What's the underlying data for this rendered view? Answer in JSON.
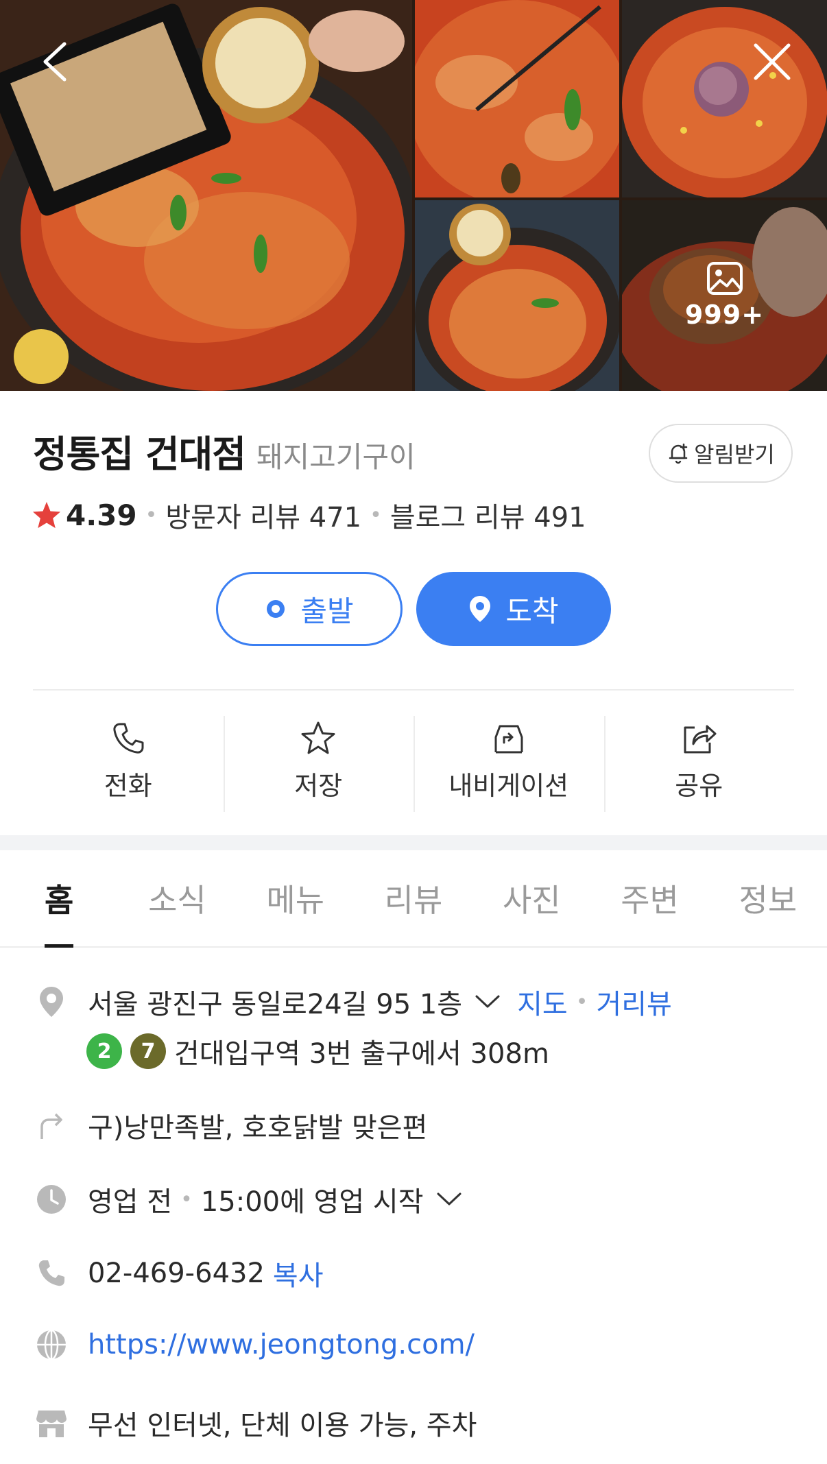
{
  "gallery": {
    "more_count": "999+"
  },
  "place": {
    "name": "정통집 건대점",
    "category": "돼지고기구이",
    "alarm_label": "알림받기",
    "rating": "4.39",
    "visitor_reviews": "방문자 리뷰 471",
    "blog_reviews": "블로그 리뷰 491"
  },
  "route": {
    "start_label": "출발",
    "arrive_label": "도착"
  },
  "actions": {
    "call": "전화",
    "save": "저장",
    "navigation": "내비게이션",
    "share": "공유"
  },
  "tabs": [
    "홈",
    "소식",
    "메뉴",
    "리뷰",
    "사진",
    "주변",
    "정보"
  ],
  "info": {
    "address": "서울 광진구 동일로24길 95 1층",
    "map_link": "지도",
    "street_view_link": "거리뷰",
    "subway_line_a": "2",
    "subway_line_b": "7",
    "subway_text": "건대입구역 3번 출구에서 308m",
    "directions": "구)낭만족발, 호호닭발 맞은편",
    "status": "영업 전",
    "hours": "15:00에 영업 시작",
    "phone": "02-469-6432",
    "copy_label": "복사",
    "website": "https://www.jeongtong.com/",
    "amenities": "무선 인터넷, 단체 이용 가능, 주차"
  },
  "colors": {
    "accent": "#3b7ff2",
    "link": "#2f6fe0",
    "star": "#e5413c",
    "line2": "#3db449",
    "line7": "#6b6a2a"
  }
}
